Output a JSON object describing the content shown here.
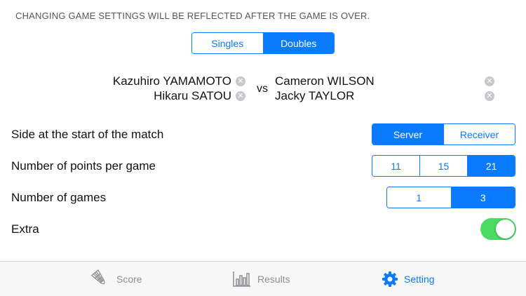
{
  "notice": "CHANGING GAME SETTINGS WILL BE REFLECTED AFTER THE GAME IS OVER.",
  "match_type": {
    "options": [
      "Singles",
      "Doubles"
    ],
    "selected": "Doubles"
  },
  "players": {
    "team_a": [
      "Kazuhiro YAMAMOTO",
      "Hikaru SATOU"
    ],
    "team_b": [
      "Cameron WILSON",
      "Jacky TAYLOR"
    ],
    "vs": "vs"
  },
  "settings": {
    "side": {
      "label": "Side at the start of the match",
      "options": [
        "Server",
        "Receiver"
      ],
      "selected": "Server"
    },
    "points": {
      "label": "Number of points per game",
      "options": [
        "11",
        "15",
        "21"
      ],
      "selected": "21"
    },
    "games": {
      "label": "Number of games",
      "options": [
        "1",
        "3"
      ],
      "selected": "3"
    },
    "extra": {
      "label": "Extra",
      "enabled": true
    }
  },
  "tabbar": {
    "tabs": [
      {
        "label": "Score",
        "icon": "shuttlecock-icon"
      },
      {
        "label": "Results",
        "icon": "bar-chart-icon"
      },
      {
        "label": "Setting",
        "icon": "gear-icon"
      }
    ],
    "active": "Setting"
  },
  "colors": {
    "accent": "#0a7aff",
    "toggle_on": "#4cd964",
    "inactive_tab": "#8e8e93"
  }
}
